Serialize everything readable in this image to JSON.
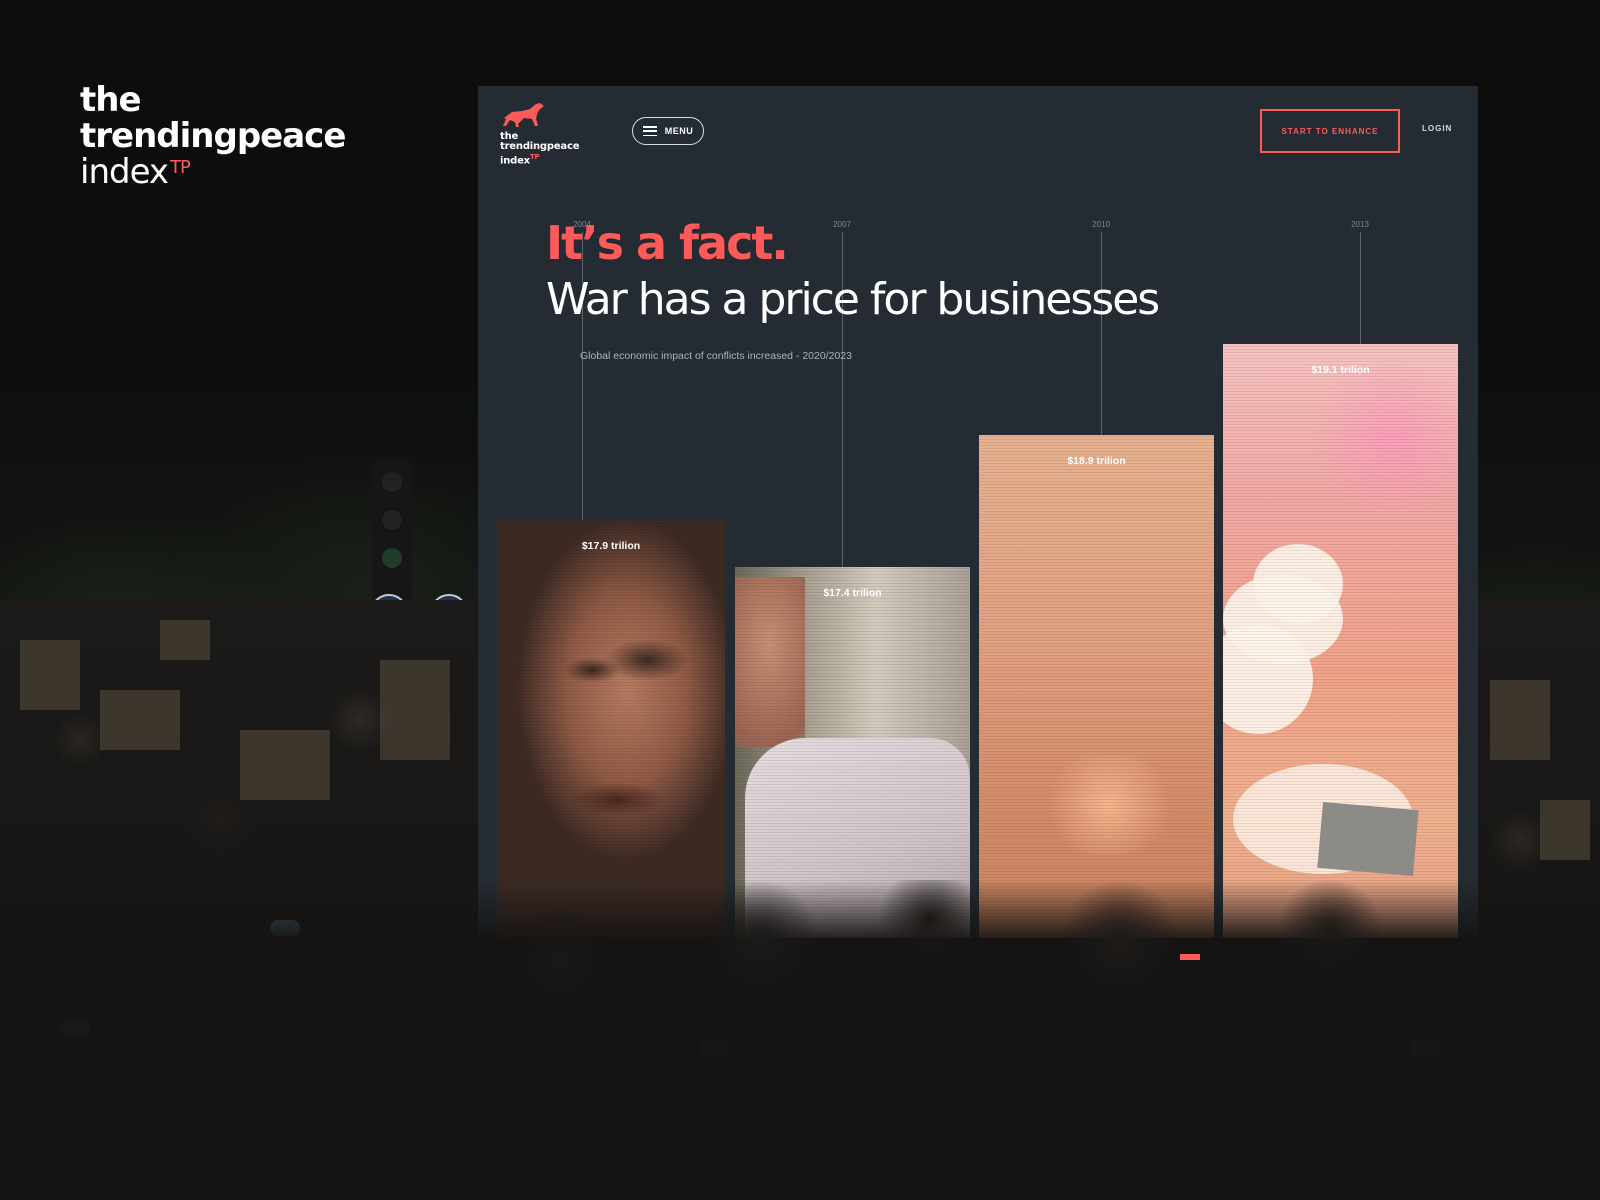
{
  "brand": {
    "line1": "the",
    "line2": "trendingpeace",
    "line3": "index",
    "superscript": "TP"
  },
  "site": {
    "logo": {
      "line1": "the",
      "line2": "trendingpeace",
      "line3": "index",
      "superscript": "TP",
      "icon": "dog-icon"
    },
    "menu_label": "MENU",
    "cta_label": "START TO ENHANCE",
    "login_label": "LOGIN",
    "headline_red": "It’s a fact.",
    "headline_white": "War has a price for businesses",
    "subtitle": "Global economic impact of conflicts increased - 2020/2023",
    "years": [
      "2004",
      "2007",
      "2010",
      "2013"
    ],
    "bars": [
      {
        "label": "$17.9 trilion",
        "value": 17.9
      },
      {
        "label": "$17.4 trilion",
        "value": 17.4
      },
      {
        "label": "$18.9 trilion",
        "value": 18.9
      },
      {
        "label": "$19.1 trilion",
        "value": 19.1
      }
    ],
    "accent_color": "#ff5a5a",
    "background_color": "#242b33"
  }
}
